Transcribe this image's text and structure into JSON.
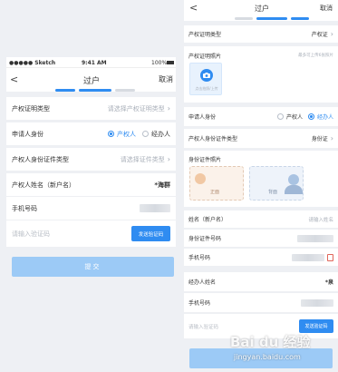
{
  "left": {
    "status": {
      "carrier": "●●●●● Sketch",
      "time": "9:41 AM",
      "battery": "100%"
    },
    "nav": {
      "back": "<",
      "title": "过户",
      "cancel": "取消"
    },
    "rows": [
      {
        "label": "产权证明类型",
        "placeholder": "请选择产权证明类型"
      },
      {
        "label": "申请人身份",
        "opt1": "产权人",
        "opt2": "经办人"
      },
      {
        "label": "产权人身份证件类型",
        "placeholder": "请选择证件类型"
      },
      {
        "label": "产权人姓名（新户名）",
        "value": "*海群"
      },
      {
        "label": "手机号码"
      },
      {
        "placeholder": "请输入验证码",
        "button": "发送验证码"
      }
    ],
    "submit": "提交"
  },
  "right": {
    "nav": {
      "back": "<",
      "title": "过户",
      "cancel": "取消"
    },
    "proof_type": {
      "label": "产权证明类型",
      "value": "产权证"
    },
    "photo": {
      "label": "产权证明照片",
      "hint": "最多可上传6张照片",
      "upload": "点击拍照/上传"
    },
    "identity": {
      "label": "申请人身份",
      "opt1": "产权人",
      "opt2": "经办人"
    },
    "id_type": {
      "label": "产权人身份证件类型",
      "value": "身份证"
    },
    "id_photo": {
      "label": "身份证件照片",
      "front": "正面",
      "back": "背面"
    },
    "name": {
      "label": "姓名（新户名）",
      "placeholder": "请输入姓名"
    },
    "id_no": {
      "label": "身份证件号码"
    },
    "phone1": {
      "label": "手机号码"
    },
    "agent_name": {
      "label": "经办人姓名",
      "value": "*泉"
    },
    "phone2": {
      "label": "手机号码"
    },
    "code": {
      "placeholder": "请输入验证码",
      "button": "发送验证码"
    }
  },
  "watermark": {
    "brand": "Bai du 经验",
    "url": "jingyan.baidu.com"
  },
  "colors": {
    "accent": "#2f8cf1",
    "submit_disabled": "#9ccaf6",
    "background": "#eef0f4"
  }
}
